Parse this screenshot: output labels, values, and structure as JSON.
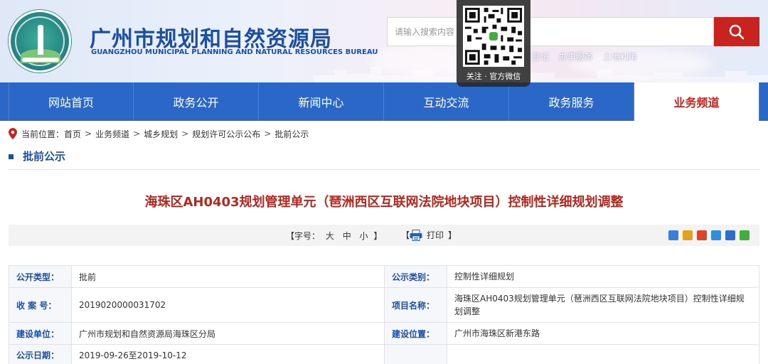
{
  "header": {
    "site_title": "广州市规划和自然资源局",
    "site_subtitle": "GUANGZHOU MUNICIPAL PLANNING AND NATURAL RESOURCES BUREAU",
    "search": {
      "placeholder": "请输入搜索内容",
      "button_icon": "search-icon",
      "button_color": "#c8231f"
    },
    "quick_links": [
      "登记",
      "办事服务",
      "土地利用"
    ],
    "qr": {
      "caption": "关注 · 官方微信",
      "icon": "qr-code"
    }
  },
  "nav": {
    "items": [
      {
        "label": "网站首页"
      },
      {
        "label": "政务公开"
      },
      {
        "label": "新闻中心"
      },
      {
        "label": "互动交流"
      },
      {
        "label": "政务服务"
      },
      {
        "label": "业务频道",
        "active": true
      }
    ],
    "bg_color": "#2a67c6"
  },
  "breadcrumb": {
    "prefix": "当前位置：",
    "items": [
      "首页",
      "业务频道",
      "城乡规划",
      "规划许可公示公布",
      "批前公示"
    ],
    "icon": "location-pin-icon"
  },
  "section": {
    "title": "批前公示"
  },
  "article": {
    "title": "海珠区AH0403规划管理单元（琶洲西区互联网法院地块项目）控制性详细规划调整",
    "font_size": {
      "label_open": "【字号：",
      "large": "大",
      "medium": "中",
      "small": "小",
      "label_close": "】"
    },
    "print": {
      "open": "【",
      "label": "打印",
      "close": "】",
      "icon": "printer-icon"
    },
    "share_icons": [
      {
        "name": "share-plus-icon",
        "color": "#3b7dd8"
      },
      {
        "name": "share-star-icon",
        "color": "#e0a31a"
      },
      {
        "name": "share-weibo-icon",
        "color": "#d9442b"
      },
      {
        "name": "share-qzone-icon",
        "color": "#2f8fd8"
      },
      {
        "name": "share-renren-icon",
        "color": "#2a6fc9"
      },
      {
        "name": "share-wechat-icon",
        "color": "#3fae3a"
      }
    ]
  },
  "info": {
    "rows": [
      {
        "label1": "公开类型：",
        "value1": "批前",
        "label2": "公示类别：",
        "value2": "控制性详细规划"
      },
      {
        "label1": "收 案 号：",
        "value1": "2019020000031702",
        "label2": "项目名称：",
        "value2": "海珠区AH0403规划管理单元（琶洲西区互联网法院地块项目）控制性详细规划调整"
      },
      {
        "label1": "建设单位：",
        "value1": "广州市规划和自然资源局海珠区分局",
        "label2": "建设位置：",
        "value2": "广州市海珠区新港东路"
      },
      {
        "label1": "公示日期：",
        "value1": "2019-09-26至2019-10-12",
        "label2": "",
        "value2": ""
      }
    ]
  }
}
